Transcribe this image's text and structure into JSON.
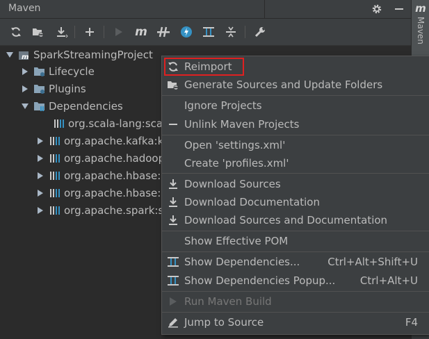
{
  "header": {
    "title": "Maven"
  },
  "rightbar": {
    "tab_icon": "m",
    "tab_label": "Maven"
  },
  "tree": {
    "project": "SparkStreamingProject",
    "children": [
      {
        "label": "Lifecycle"
      },
      {
        "label": "Plugins"
      },
      {
        "label": "Dependencies"
      }
    ],
    "dependencies": [
      "org.scala-lang:scala",
      "org.apache.kafka:k",
      "org.apache.hadoop",
      "org.apache.hbase:l",
      "org.apache.hbase:l",
      "org.apache.spark:s"
    ]
  },
  "menu": {
    "reimport": "Reimport",
    "generate": "Generate Sources and Update Folders",
    "ignore": "Ignore Projects",
    "unlink": "Unlink Maven Projects",
    "open_settings": "Open 'settings.xml'",
    "create_profiles": "Create 'profiles.xml'",
    "download_sources": "Download Sources",
    "download_docs": "Download Documentation",
    "download_both": "Download Sources and Documentation",
    "effective_pom": "Show Effective POM",
    "show_deps": "Show Dependencies...",
    "show_deps_sc": "Ctrl+Alt+Shift+U",
    "show_deps_popup": "Show Dependencies Popup...",
    "show_deps_popup_sc": "Ctrl+Alt+U",
    "run_build": "Run Maven Build",
    "jump_source": "Jump to Source",
    "jump_source_sc": "F4"
  },
  "colors": {
    "background": "#2b2b2b",
    "menu_bg": "#3c3f41",
    "text": "#bbbbbb",
    "highlight": "#e02020",
    "accent_blue": "#3592c4"
  }
}
